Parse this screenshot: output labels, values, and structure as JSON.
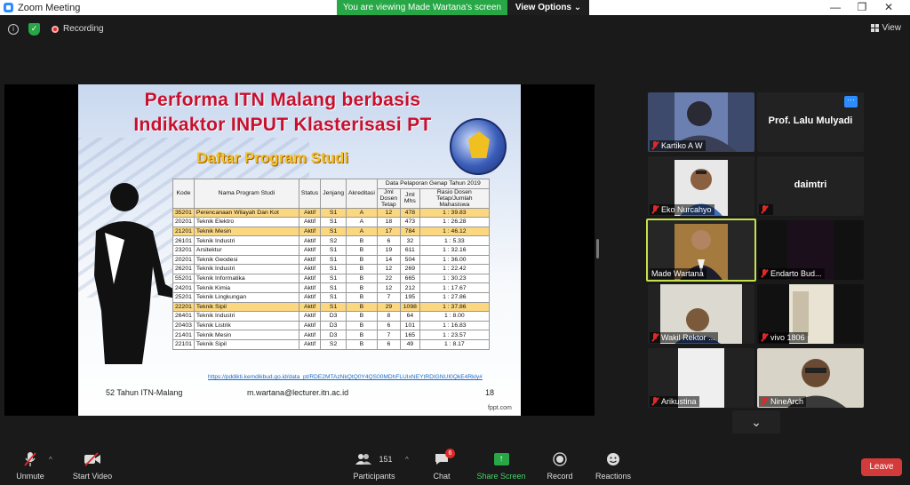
{
  "window": {
    "title": "Zoom Meeting",
    "minimize": "—",
    "maximize": "❐",
    "close": "✕"
  },
  "banner": {
    "viewing": "You are viewing Made Wartana's screen",
    "view_options": "View Options ⌄"
  },
  "topbar": {
    "recording": "Recording",
    "view": "View"
  },
  "slide": {
    "title_line1": "Performa ITN Malang berbasis",
    "title_line2": "Indikaktor INPUT Klasterisasi PT",
    "subtitle": "Daftar Program Studi",
    "report_header": "Data Pelaporan Genap Tahun 2019",
    "columns": [
      "Kode",
      "Nama Program Studi",
      "Status",
      "Jenjang",
      "Akreditasi",
      "Jml Dosen Tetap",
      "Jml Mhs",
      "Rasio Dosen Tetap/Jumlah Mahasiswa"
    ],
    "rows": [
      {
        "kode": "35201",
        "nama": "Perencanaan Wilayah Dan Kot",
        "status": "Aktif",
        "jenjang": "S1",
        "akreditasi": "A",
        "dosen": "12",
        "mhs": "478",
        "rasio": "1 : 39.83",
        "highlight": true
      },
      {
        "kode": "20201",
        "nama": "Teknik Elektro",
        "status": "Aktif",
        "jenjang": "S1",
        "akreditasi": "A",
        "dosen": "18",
        "mhs": "473",
        "rasio": "1 : 26.28",
        "highlight": false
      },
      {
        "kode": "21201",
        "nama": "Teknik Mesin",
        "status": "Aktif",
        "jenjang": "S1",
        "akreditasi": "A",
        "dosen": "17",
        "mhs": "784",
        "rasio": "1 : 46.12",
        "highlight": true
      },
      {
        "kode": "26101",
        "nama": "Teknik Industri",
        "status": "Aktif",
        "jenjang": "S2",
        "akreditasi": "B",
        "dosen": "6",
        "mhs": "32",
        "rasio": "1 : 5.33",
        "highlight": false
      },
      {
        "kode": "23201",
        "nama": "Arsitektur",
        "status": "Aktif",
        "jenjang": "S1",
        "akreditasi": "B",
        "dosen": "19",
        "mhs": "611",
        "rasio": "1 : 32.16",
        "highlight": false
      },
      {
        "kode": "20201",
        "nama": "Teknik Geodesi",
        "status": "Aktif",
        "jenjang": "S1",
        "akreditasi": "B",
        "dosen": "14",
        "mhs": "504",
        "rasio": "1 : 36.00",
        "highlight": false
      },
      {
        "kode": "26201",
        "nama": "Teknik Industri",
        "status": "Aktif",
        "jenjang": "S1",
        "akreditasi": "B",
        "dosen": "12",
        "mhs": "269",
        "rasio": "1 : 22.42",
        "highlight": false
      },
      {
        "kode": "55201",
        "nama": "Teknik Informatika",
        "status": "Aktif",
        "jenjang": "S1",
        "akreditasi": "B",
        "dosen": "22",
        "mhs": "665",
        "rasio": "1 : 30.23",
        "highlight": false
      },
      {
        "kode": "24201",
        "nama": "Teknik Kimia",
        "status": "Aktif",
        "jenjang": "S1",
        "akreditasi": "B",
        "dosen": "12",
        "mhs": "212",
        "rasio": "1 : 17.67",
        "highlight": false
      },
      {
        "kode": "25201",
        "nama": "Teknik Lingkungan",
        "status": "Aktif",
        "jenjang": "S1",
        "akreditasi": "B",
        "dosen": "7",
        "mhs": "195",
        "rasio": "1 : 27.86",
        "highlight": false
      },
      {
        "kode": "22201",
        "nama": "Teknik Sipil",
        "status": "Aktif",
        "jenjang": "S1",
        "akreditasi": "B",
        "dosen": "29",
        "mhs": "1098",
        "rasio": "1 : 37.86",
        "highlight": true
      },
      {
        "kode": "26401",
        "nama": "Teknik Industri",
        "status": "Aktif",
        "jenjang": "D3",
        "akreditasi": "B",
        "dosen": "8",
        "mhs": "64",
        "rasio": "1 : 8.00",
        "highlight": false
      },
      {
        "kode": "20403",
        "nama": "Teknik Listrik",
        "status": "Aktif",
        "jenjang": "D3",
        "akreditasi": "B",
        "dosen": "6",
        "mhs": "101",
        "rasio": "1 : 16.83",
        "highlight": false
      },
      {
        "kode": "21401",
        "nama": "Teknik Mesin",
        "status": "Aktif",
        "jenjang": "D3",
        "akreditasi": "B",
        "dosen": "7",
        "mhs": "165",
        "rasio": "1 : 23.57",
        "highlight": false
      },
      {
        "kode": "22101",
        "nama": "Teknik Sipil",
        "status": "Aktif",
        "jenjang": "S2",
        "akreditasi": "B",
        "dosen": "6",
        "mhs": "49",
        "rasio": "1 : 8.17",
        "highlight": false
      }
    ],
    "link": "https://pddikti.kemdikbud.go.id/data_pt/RDE2MTAzNkQtQ0Y4QS00MDhFLUIxNEYtRDIGNUI0QkE4Rkly#",
    "footer_left": "52 Tahun ITN-Malang",
    "footer_email": "m.wartana@lecturer.itn.ac.id",
    "page_number": "18",
    "brand": "fppt.com"
  },
  "participants": [
    {
      "name": "Kartiko A W",
      "muted": true,
      "video": true
    },
    {
      "name": "Prof. Lalu Mulyadi",
      "muted": false,
      "video": false
    },
    {
      "name": "Eko Nurcahyo",
      "muted": true,
      "video": true
    },
    {
      "name": "daimtri",
      "muted": true,
      "video": false
    },
    {
      "name": "Made Wartana",
      "muted": false,
      "video": true,
      "active": true
    },
    {
      "name": "Endarto Bud...",
      "muted": true,
      "video": true
    },
    {
      "name": "Wakil Rektor ...",
      "muted": true,
      "video": true
    },
    {
      "name": "vivo 1806",
      "muted": true,
      "video": true
    },
    {
      "name": "Arikustina",
      "muted": true,
      "video": true
    },
    {
      "name": "NineArch",
      "muted": true,
      "video": true
    }
  ],
  "toolbar": {
    "unmute": "Unmute",
    "start_video": "Start Video",
    "participants": "Participants",
    "participants_count": "151",
    "chat": "Chat",
    "chat_badge": "6",
    "share_screen": "Share Screen",
    "record": "Record",
    "reactions": "Reactions",
    "leave": "Leave"
  }
}
